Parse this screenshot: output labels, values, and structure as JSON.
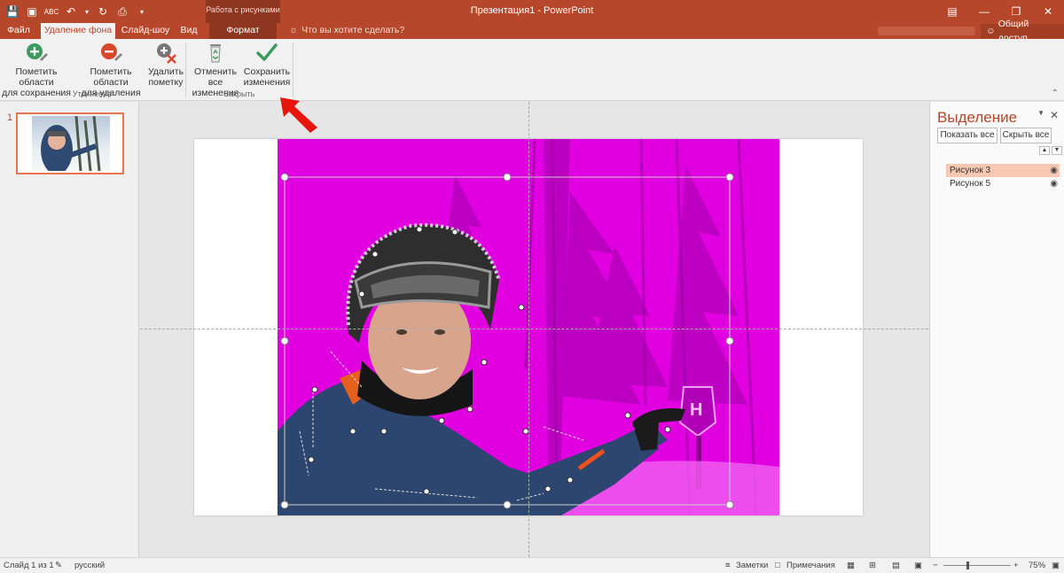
{
  "window": {
    "title": "Презентация1 - PowerPoint",
    "context_group": "Работа с рисунками"
  },
  "tabs": [
    {
      "label": "Файл"
    },
    {
      "label": "Удаление фона"
    },
    {
      "label": "Слайд-шоу"
    },
    {
      "label": "Вид"
    },
    {
      "label": "Формат"
    }
  ],
  "tell_me": "Что вы хотите сделать?",
  "share_label": "Общий доступ",
  "ribbon": {
    "mark_keep": {
      "line1": "Пометить области",
      "line2": "для сохранения"
    },
    "mark_remove": {
      "line1": "Пометить области",
      "line2": "для удаления"
    },
    "delete_mark": {
      "line1": "Удалить",
      "line2": "пометку"
    },
    "discard": {
      "line1": "Отменить все",
      "line2": "изменения"
    },
    "keep": {
      "line1": "Сохранить",
      "line2": "изменения"
    },
    "group_refine": "Уточнение",
    "group_close": "Закрыть"
  },
  "slides_pane": {
    "slide_number": "1"
  },
  "selection_pane": {
    "title": "Выделение",
    "show_all": "Показать все",
    "hide_all": "Скрыть все",
    "items": [
      {
        "label": "Рисунок 3",
        "selected": true
      },
      {
        "label": "Рисунок 5",
        "selected": false
      }
    ]
  },
  "status": {
    "slide_info": "Слайд 1 из 1",
    "language": "русский",
    "notes": "Заметки",
    "comments": "Примечания",
    "zoom": "75%"
  },
  "colors": {
    "accent": "#b7472a",
    "remove_overlay": "#e000e0",
    "annotation_arrow": "#e8150e"
  }
}
